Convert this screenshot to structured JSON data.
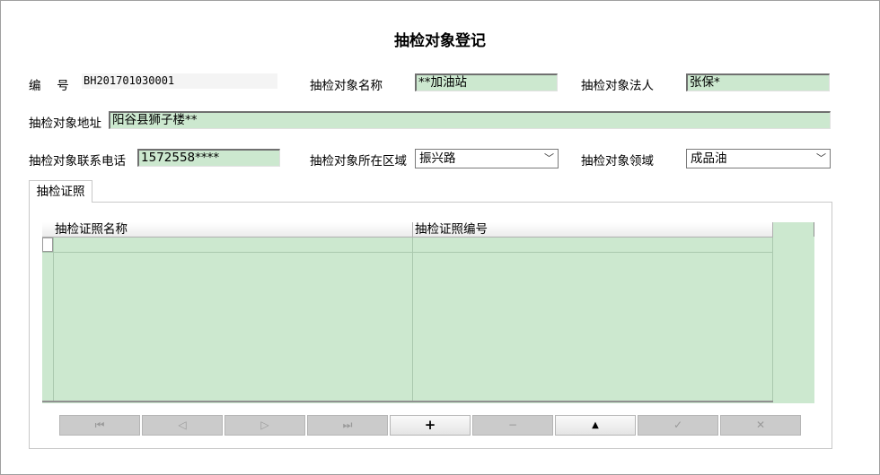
{
  "page": {
    "title": "抽检对象登记"
  },
  "form": {
    "code_label": "编　 号",
    "code_value": "BH201701030001",
    "name_label": "抽检对象名称",
    "name_value": "**加油站",
    "legal_label": "抽检对象法人",
    "legal_value": "张保*",
    "address_label": "抽检对象地址",
    "address_value": "阳谷县狮子楼**",
    "phone_label": "抽检对象联系电话",
    "phone_value": "1572558****",
    "region_label": "抽检对象所在区域",
    "region_value": "振兴路",
    "domain_label": "抽检对象领域",
    "domain_value": "成品油"
  },
  "tabs": [
    {
      "label": "抽检证照"
    }
  ],
  "grid": {
    "columns": [
      "抽检证照名称",
      "抽检证照编号"
    ],
    "rows": []
  },
  "navigator": {
    "first": "⏮",
    "prior": "◁",
    "next": "▷",
    "last": "⏭",
    "insert": "+",
    "delete": "−",
    "edit": "▲",
    "post": "✓",
    "cancel": "✕"
  },
  "colors": {
    "field_bg": "#cce8cf",
    "disabled_button": "#cbcbcb"
  }
}
